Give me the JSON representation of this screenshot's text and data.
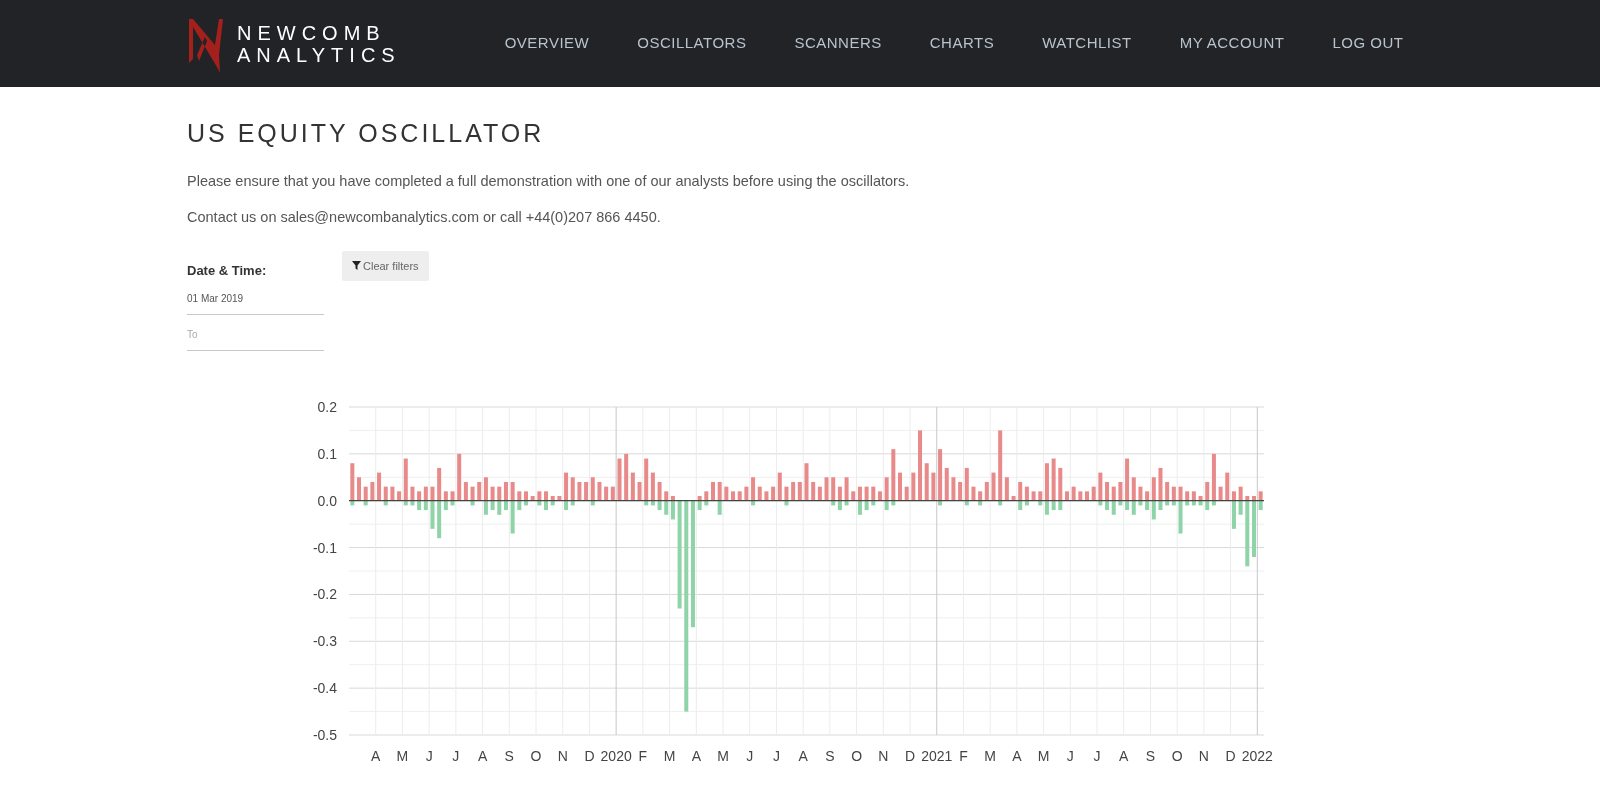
{
  "header": {
    "logo": {
      "line_1": "NEWCOMB",
      "line_2": "ANALYTICS"
    },
    "nav": [
      {
        "label": "OVERVIEW"
      },
      {
        "label": "OSCILLATORS"
      },
      {
        "label": "SCANNERS"
      },
      {
        "label": "CHARTS"
      },
      {
        "label": "WATCHLIST"
      },
      {
        "label": "MY ACCOUNT"
      },
      {
        "label": "LOG OUT"
      }
    ]
  },
  "page": {
    "title": "US EQUITY OSCILLATOR",
    "intro": "Please ensure that you have completed a full demonstration with one of our analysts before using the oscillators.",
    "contact": "Contact us on sales@newcombanalytics.com or call +44(0)207 866 4450."
  },
  "filters": {
    "label": "Date & Time:",
    "from": {
      "value": "01 Mar 2019"
    },
    "to": {
      "placeholder": "To"
    },
    "clear_button": "Clear filters"
  },
  "chart": {
    "chart_data": {
      "type": "bar",
      "stacked": true,
      "grid": true,
      "ylim": [
        -0.5,
        0.2
      ],
      "categories": [
        null,
        null,
        null,
        null,
        "A",
        null,
        null,
        null,
        "M",
        null,
        null,
        null,
        "J",
        null,
        null,
        null,
        "J",
        null,
        null,
        null,
        "A",
        null,
        null,
        null,
        "S",
        null,
        null,
        null,
        "O",
        null,
        null,
        null,
        "N",
        null,
        null,
        null,
        "D",
        null,
        null,
        null,
        "2020",
        null,
        null,
        null,
        "F",
        null,
        null,
        null,
        "M",
        null,
        null,
        null,
        "A",
        null,
        null,
        null,
        "M",
        null,
        null,
        null,
        "J",
        null,
        null,
        null,
        "J",
        null,
        null,
        null,
        "A",
        null,
        null,
        null,
        "S",
        null,
        null,
        null,
        "O",
        null,
        null,
        null,
        "N",
        null,
        null,
        null,
        "D",
        null,
        null,
        null,
        "2021",
        null,
        null,
        null,
        "F",
        null,
        null,
        null,
        "M",
        null,
        null,
        null,
        "A",
        null,
        null,
        null,
        "M",
        null,
        null,
        null,
        "J",
        null,
        null,
        null,
        "J",
        null,
        null,
        null,
        "A",
        null,
        null,
        null,
        "S",
        null,
        null,
        null,
        "O",
        null,
        null,
        null,
        "N",
        null,
        null,
        null,
        "D",
        null,
        null,
        null,
        "2022"
      ],
      "yticks": [
        {
          "value": 0.2,
          "label": "0.2"
        },
        {
          "value": 0.1,
          "label": "0.1"
        },
        {
          "value": 0,
          "label": "0.0"
        },
        {
          "value": -0.1,
          "label": "-0.1"
        },
        {
          "value": -0.2,
          "label": "-0.2"
        },
        {
          "value": -0.3,
          "label": "-0.3"
        },
        {
          "value": -0.4,
          "label": "-0.4"
        },
        {
          "value": -0.5,
          "label": "-0.5"
        }
      ],
      "series": [
        {
          "color": "#e8898a",
          "values": [
            0.08,
            0.05,
            0.03,
            0.04,
            0.06,
            0.03,
            0.03,
            0.02,
            0.09,
            0.03,
            0.02,
            0.03,
            0.03,
            0.07,
            0.02,
            0.02,
            0.1,
            0.04,
            0.03,
            0.04,
            0.05,
            0.03,
            0.03,
            0.04,
            0.04,
            0.02,
            0.02,
            0.01,
            0.02,
            0.02,
            0.01,
            0.01,
            0.06,
            0.05,
            0.04,
            0.04,
            0.05,
            0.04,
            0.03,
            0.03,
            0.09,
            0.1,
            0.06,
            0.04,
            0.09,
            0.06,
            0.04,
            0.02,
            0.01,
            0,
            0,
            0,
            0.01,
            0.02,
            0.04,
            0.04,
            0.03,
            0.02,
            0.02,
            0.03,
            0.05,
            0.03,
            0.02,
            0.03,
            0.06,
            0.03,
            0.04,
            0.04,
            0.08,
            0.04,
            0.03,
            0.05,
            0.05,
            0.03,
            0.05,
            0.02,
            0.03,
            0.03,
            0.03,
            0.02,
            0.05,
            0.11,
            0.06,
            0.03,
            0.06,
            0.15,
            0.08,
            0.06,
            0.11,
            0.07,
            0.05,
            0.04,
            0.07,
            0.03,
            0.02,
            0.04,
            0.06,
            0.15,
            0.05,
            0.01,
            0.04,
            0.03,
            0.02,
            0.02,
            0.08,
            0.09,
            0.07,
            0.02,
            0.03,
            0.02,
            0.02,
            0.03,
            0.06,
            0.04,
            0.03,
            0.04,
            0.09,
            0.05,
            0.03,
            0.02,
            0.05,
            0.07,
            0.04,
            0.03,
            0.03,
            0.02,
            0.02,
            0.01,
            0.04,
            0.1,
            0.03,
            0.06,
            0.02,
            0.03,
            0.01,
            0.01,
            0.02
          ]
        },
        {
          "color": "#8fd3a8",
          "values": [
            -0.01,
            0,
            -0.01,
            0,
            0,
            -0.01,
            0,
            0,
            -0.01,
            -0.01,
            -0.02,
            -0.02,
            -0.06,
            -0.08,
            -0.02,
            -0.01,
            0,
            0,
            -0.01,
            0,
            -0.03,
            -0.02,
            -0.03,
            -0.02,
            -0.07,
            -0.02,
            -0.01,
            0,
            -0.01,
            -0.02,
            -0.01,
            0,
            -0.02,
            -0.01,
            0,
            0,
            -0.01,
            0,
            0,
            0,
            0,
            0,
            0,
            0,
            -0.01,
            -0.01,
            -0.02,
            -0.03,
            -0.04,
            -0.23,
            -0.45,
            -0.27,
            -0.02,
            -0.01,
            0,
            -0.03,
            0,
            0,
            0,
            0,
            -0.01,
            0,
            0,
            0,
            0,
            -0.01,
            0,
            0,
            0,
            0,
            0,
            0,
            -0.01,
            -0.02,
            -0.01,
            0,
            -0.03,
            -0.02,
            -0.01,
            0,
            -0.02,
            -0.01,
            0,
            0,
            0,
            0,
            0,
            0,
            -0.01,
            0,
            0,
            0,
            -0.01,
            0,
            -0.01,
            0,
            0,
            -0.01,
            0,
            0,
            -0.02,
            -0.01,
            0,
            -0.01,
            -0.03,
            -0.02,
            -0.02,
            0,
            0,
            0,
            0,
            0,
            -0.01,
            -0.02,
            -0.03,
            -0.01,
            -0.02,
            -0.03,
            -0.01,
            -0.02,
            -0.04,
            -0.02,
            -0.01,
            -0.01,
            -0.07,
            -0.01,
            -0.01,
            -0.01,
            -0.02,
            -0.01,
            0,
            0,
            -0.06,
            -0.03,
            -0.14,
            -0.12,
            -0.02
          ]
        }
      ]
    }
  }
}
